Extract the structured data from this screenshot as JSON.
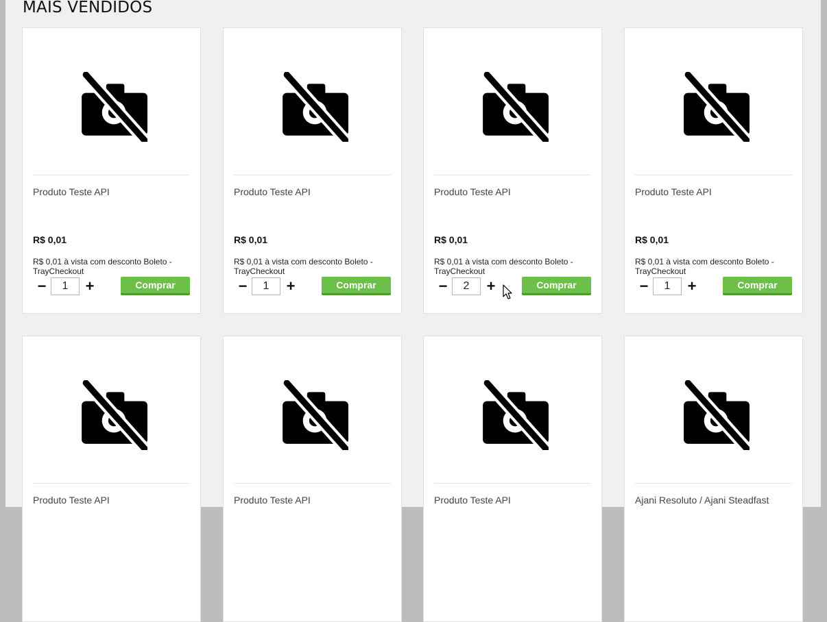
{
  "section": {
    "title": "MAIS VENDIDOS"
  },
  "products": [
    {
      "name": "Produto Teste API",
      "price": "R$ 0,01",
      "condition": "R$ 0,01 à vista com desconto Boleto - TrayCheckout",
      "quantity": "1",
      "buy_label": "Comprar"
    },
    {
      "name": "Produto Teste API",
      "price": "R$ 0,01",
      "condition": "R$ 0,01 à vista com desconto Boleto - TrayCheckout",
      "quantity": "1",
      "buy_label": "Comprar"
    },
    {
      "name": "Produto Teste API",
      "price": "R$ 0,01",
      "condition": "R$ 0,01 à vista com desconto Boleto - TrayCheckout",
      "quantity": "2",
      "buy_label": "Comprar"
    },
    {
      "name": "Produto Teste API",
      "price": "R$ 0,01",
      "condition": "R$ 0,01 à vista com desconto Boleto - TrayCheckout",
      "quantity": "1",
      "buy_label": "Comprar"
    },
    {
      "name": "Produto Teste API"
    },
    {
      "name": "Produto Teste API"
    },
    {
      "name": "Produto Teste API"
    },
    {
      "name": "Ajani Resoluto / Ajani Steadfast"
    }
  ],
  "quantity_controls": {
    "minus_label": "−",
    "plus_label": "+"
  },
  "icons": {
    "product_image": "no-photo-icon",
    "pointer": "mouse-cursor-icon"
  },
  "colors": {
    "buy_button": "#6cc04a",
    "page_background": "#f0f0f0"
  }
}
